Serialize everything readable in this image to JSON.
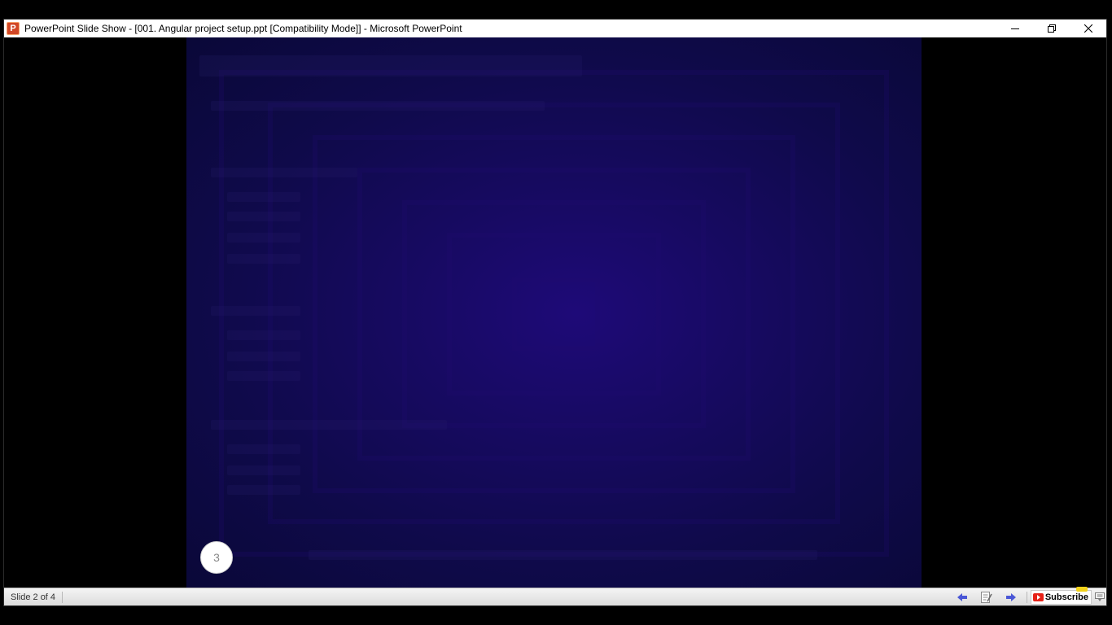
{
  "window": {
    "title": "PowerPoint Slide Show - [001. Angular project setup.ppt [Compatibility Mode]] - Microsoft PowerPoint",
    "app_icon_letter": "P"
  },
  "slide": {
    "number_badge": "3"
  },
  "statusbar": {
    "slide_indicator": "Slide 2 of 4",
    "subscribe_label": "Subscribe"
  },
  "icons": {
    "app": "powerpoint-icon",
    "minimize": "minimize-icon",
    "restore": "restore-icon",
    "close": "close-icon",
    "previous": "arrow-left-icon",
    "notes": "notes-icon",
    "next": "arrow-right-icon",
    "youtube": "youtube-icon",
    "menu": "menu-icon"
  },
  "colors": {
    "slide_center": "#1e0a78",
    "slide_edge": "#0a0838",
    "app_icon": "#d24726",
    "nav_arrow": "#4a57d6",
    "youtube_red": "#e62117"
  }
}
